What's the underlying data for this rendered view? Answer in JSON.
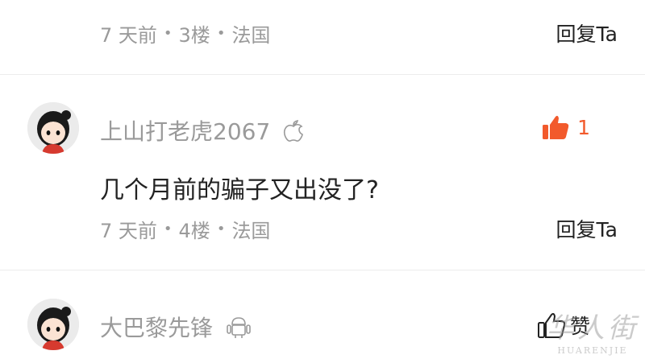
{
  "comments_top": {
    "time": "7 天前",
    "floor": "3楼",
    "location": "法国",
    "separator": "•",
    "reply_label": "回复Ta"
  },
  "comment2": {
    "username": "上山打老虎2067",
    "platform_icon": "apple-icon",
    "like_count": "1",
    "like_color": "#f25a2c",
    "text": "几个月前的骗子又出没了?",
    "time": "7 天前",
    "floor": "4楼",
    "location": "法国",
    "separator": "•",
    "reply_label": "回复Ta"
  },
  "comment3": {
    "username": "大巴黎先锋",
    "platform_icon": "android-icon",
    "like_label": "赞"
  },
  "watermark": {
    "logo_text": "华人街",
    "site": "HUARENJIE"
  }
}
